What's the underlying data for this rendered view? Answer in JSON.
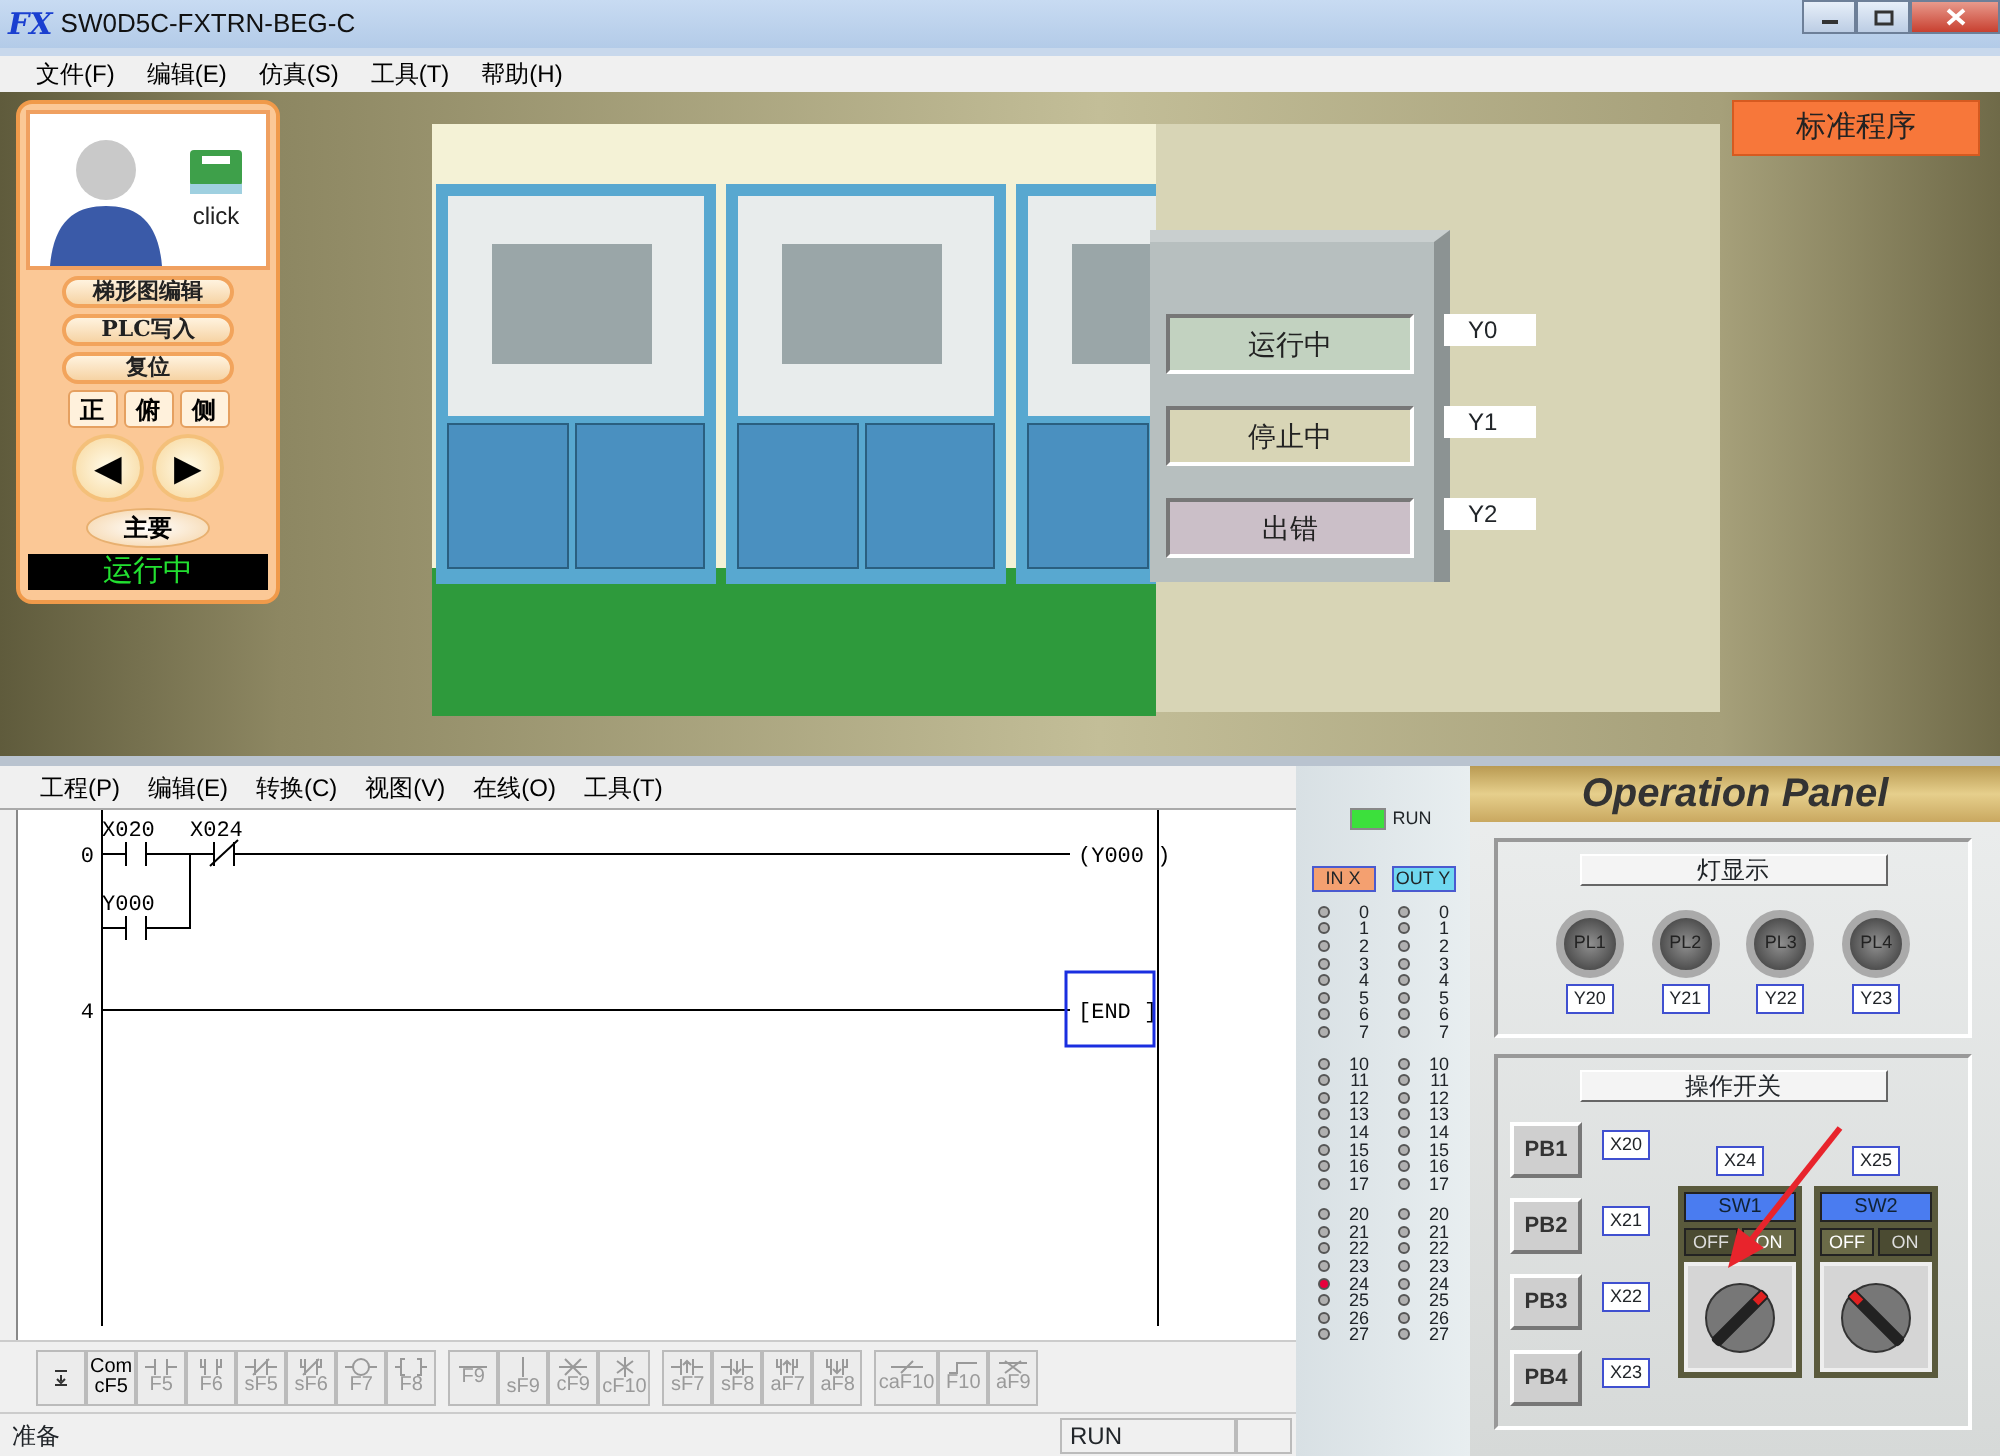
{
  "window": {
    "logo": "FX",
    "title": "SW0D5C-FXTRN-BEG-C"
  },
  "menu": [
    "文件(F)",
    "编辑(E)",
    "仿真(S)",
    "工具(T)",
    "帮助(H)"
  ],
  "guide_panel": {
    "book_label": "click",
    "buttons": [
      "梯形图编辑",
      "PLC写入",
      "复位"
    ],
    "views": [
      "正",
      "俯",
      "侧"
    ],
    "nav": [
      "◀",
      "▶"
    ],
    "main_button": "主要",
    "status": "运行中"
  },
  "program_button": "标准程序",
  "control_box": {
    "lamps": [
      {
        "label": "运行中",
        "address": "Y0",
        "color": "#c2d2c0"
      },
      {
        "label": "停止中",
        "address": "Y1",
        "color": "#d8d5b6"
      },
      {
        "label": "出错",
        "address": "Y2",
        "color": "#cbbfc8"
      }
    ]
  },
  "ladder": {
    "menu": [
      "工程(P)",
      "编辑(E)",
      "转换(C)",
      "视图(V)",
      "在线(O)",
      "工具(T)"
    ],
    "rungs": [
      {
        "step": "0",
        "contacts": [
          {
            "label": "X020",
            "kind": "no"
          },
          {
            "label": "X024",
            "kind": "nc"
          }
        ],
        "branch": [
          {
            "label": "Y000",
            "kind": "no"
          }
        ],
        "output": "(Y000 )",
        "selected": false
      },
      {
        "step": "4",
        "output": "[END ]",
        "selected": true
      }
    ],
    "toolbar": [
      [
        {
          "kind": "mode"
        },
        {
          "kind": "comment",
          "top": "Com",
          "key": "cF5"
        },
        {
          "kind": "no",
          "key": "F5"
        },
        {
          "kind": "pno",
          "key": "F6"
        },
        {
          "kind": "nc",
          "key": "sF5"
        },
        {
          "kind": "pnc",
          "key": "sF6"
        },
        {
          "kind": "coil",
          "key": "F7"
        },
        {
          "kind": "instr",
          "key": "F8"
        }
      ],
      [
        {
          "kind": "hline",
          "key": "F9"
        },
        {
          "kind": "vline",
          "key": "sF9"
        },
        {
          "kind": "delh",
          "key": "cF9"
        },
        {
          "kind": "delv",
          "key": "cF10"
        }
      ],
      [
        {
          "kind": "rise",
          "key": "sF7"
        },
        {
          "kind": "fall",
          "key": "sF8"
        },
        {
          "kind": "prise",
          "key": "aF7"
        },
        {
          "kind": "pfall",
          "key": "aF8"
        }
      ],
      [
        {
          "kind": "invert",
          "key": "caF10"
        },
        {
          "kind": "line",
          "key": "F10"
        },
        {
          "kind": "delline",
          "key": "aF9"
        }
      ]
    ],
    "status": [
      "准备",
      "RUN"
    ]
  },
  "io_monitor": {
    "run": {
      "label": "RUN",
      "on": true
    },
    "columns": [
      {
        "header": "IN X",
        "kind": "input",
        "groups": [
          [
            {
              "n": "0",
              "on": false
            },
            {
              "n": "1",
              "on": false
            },
            {
              "n": "2",
              "on": false
            },
            {
              "n": "3",
              "on": false
            },
            {
              "n": "4",
              "on": false
            },
            {
              "n": "5",
              "on": false
            },
            {
              "n": "6",
              "on": false
            },
            {
              "n": "7",
              "on": false
            }
          ],
          [
            {
              "n": "10",
              "on": false
            },
            {
              "n": "11",
              "on": false
            },
            {
              "n": "12",
              "on": false
            },
            {
              "n": "13",
              "on": false
            },
            {
              "n": "14",
              "on": false
            },
            {
              "n": "15",
              "on": false
            },
            {
              "n": "16",
              "on": false
            },
            {
              "n": "17",
              "on": false
            }
          ],
          [
            {
              "n": "20",
              "on": false
            },
            {
              "n": "21",
              "on": false
            },
            {
              "n": "22",
              "on": false
            },
            {
              "n": "23",
              "on": false
            },
            {
              "n": "24",
              "on": true
            },
            {
              "n": "25",
              "on": false
            },
            {
              "n": "26",
              "on": false
            },
            {
              "n": "27",
              "on": false
            }
          ]
        ]
      },
      {
        "header": "OUT Y",
        "kind": "output",
        "groups": [
          [
            {
              "n": "0",
              "on": false
            },
            {
              "n": "1",
              "on": false
            },
            {
              "n": "2",
              "on": false
            },
            {
              "n": "3",
              "on": false
            },
            {
              "n": "4",
              "on": false
            },
            {
              "n": "5",
              "on": false
            },
            {
              "n": "6",
              "on": false
            },
            {
              "n": "7",
              "on": false
            }
          ],
          [
            {
              "n": "10",
              "on": false
            },
            {
              "n": "11",
              "on": false
            },
            {
              "n": "12",
              "on": false
            },
            {
              "n": "13",
              "on": false
            },
            {
              "n": "14",
              "on": false
            },
            {
              "n": "15",
              "on": false
            },
            {
              "n": "16",
              "on": false
            },
            {
              "n": "17",
              "on": false
            }
          ],
          [
            {
              "n": "20",
              "on": false
            },
            {
              "n": "21",
              "on": false
            },
            {
              "n": "22",
              "on": false
            },
            {
              "n": "23",
              "on": false
            },
            {
              "n": "24",
              "on": false
            },
            {
              "n": "25",
              "on": false
            },
            {
              "n": "26",
              "on": false
            },
            {
              "n": "27",
              "on": false
            }
          ]
        ]
      }
    ]
  },
  "operation_panel": {
    "title": "Operation Panel",
    "lamp_section": {
      "title": "灯显示",
      "lamps": [
        {
          "label": "PL1",
          "address": "Y20",
          "on": false
        },
        {
          "label": "PL2",
          "address": "Y21",
          "on": false
        },
        {
          "label": "PL3",
          "address": "Y22",
          "on": false
        },
        {
          "label": "PL4",
          "address": "Y23",
          "on": false
        }
      ]
    },
    "switch_section": {
      "title": "操作开关",
      "push_buttons": [
        {
          "label": "PB1",
          "address": "X20"
        },
        {
          "label": "PB2",
          "address": "X21"
        },
        {
          "label": "PB3",
          "address": "X22"
        },
        {
          "label": "PB4",
          "address": "X23"
        }
      ],
      "selectors": [
        {
          "label": "SW1",
          "address": "X24",
          "off_label": "OFF",
          "on_label": "ON",
          "on": true
        },
        {
          "label": "SW2",
          "address": "X25",
          "off_label": "OFF",
          "on_label": "ON",
          "on": false
        }
      ]
    }
  }
}
